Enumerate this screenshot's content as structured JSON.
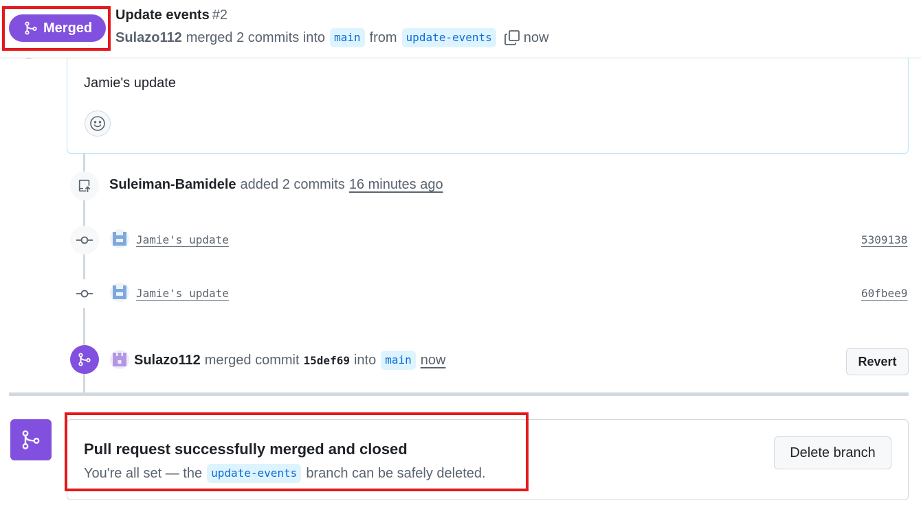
{
  "header": {
    "status_badge": "Merged",
    "title": "Update events",
    "number": "#2",
    "author": "Sulazo112",
    "merged_text": "merged 2 commits into",
    "base_branch": "main",
    "from_text": "from",
    "head_branch": "update-events",
    "time": "now"
  },
  "comment": {
    "body": "Jamie's update"
  },
  "timeline": {
    "push_event": {
      "actor": "Suleiman-Bamidele",
      "action": "added 2 commits",
      "time": "16 minutes ago"
    },
    "commits": [
      {
        "message": "Jamie's update",
        "sha": "5309138"
      },
      {
        "message": "Jamie's update",
        "sha": "60fbee9"
      }
    ],
    "merge_event": {
      "actor": "Sulazo112",
      "action": "merged commit",
      "commit": "15def69",
      "into_text": "into",
      "branch": "main",
      "time": "now",
      "revert_label": "Revert"
    }
  },
  "merge_status": {
    "title": "Pull request successfully merged and closed",
    "desc_prefix": "You're all set — the",
    "branch": "update-events",
    "desc_suffix": "branch can be safely deleted.",
    "delete_label": "Delete branch"
  },
  "colors": {
    "merged_purple": "#8250df",
    "highlight_red": "#e3191d",
    "branch_chip_bg": "#ddf4ff",
    "branch_chip_text": "#0969da"
  }
}
